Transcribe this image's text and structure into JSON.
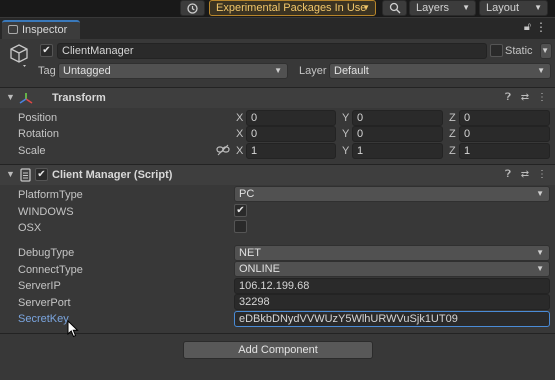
{
  "toolbar": {
    "experimental_label": "Experimental Packages In Use",
    "layers_label": "Layers",
    "layout_label": "Layout"
  },
  "tab": {
    "label": "Inspector"
  },
  "gameobject": {
    "name": "ClientManager",
    "static_label": "Static",
    "tag_label": "Tag",
    "tag_value": "Untagged",
    "layer_label": "Layer",
    "layer_value": "Default"
  },
  "transform": {
    "title": "Transform",
    "position_label": "Position",
    "rotation_label": "Rotation",
    "scale_label": "Scale",
    "position": {
      "x": "0",
      "y": "0",
      "z": "0"
    },
    "rotation": {
      "x": "0",
      "y": "0",
      "z": "0"
    },
    "scale": {
      "x": "1",
      "y": "1",
      "z": "1"
    },
    "axis_x": "X",
    "axis_y": "Y",
    "axis_z": "Z"
  },
  "client_manager": {
    "title": "Client Manager (Script)",
    "platform_type_label": "PlatformType",
    "platform_type_value": "PC",
    "windows_label": "WINDOWS",
    "windows_checked": true,
    "osx_label": "OSX",
    "osx_checked": false,
    "debug_type_label": "DebugType",
    "debug_type_value": "NET",
    "connect_type_label": "ConnectType",
    "connect_type_value": "ONLINE",
    "server_ip_label": "ServerIP",
    "server_ip_value": "106.12.199.68",
    "server_port_label": "ServerPort",
    "server_port_value": "32298",
    "secret_key_label": "SecretKey",
    "secret_key_value": "eDBkbDNydVVWUzY5WlhURWVuSjk1UT09"
  },
  "add_component_label": "Add Component",
  "colors": {
    "accent": "#3a79bb",
    "experimental": "#f1c66a",
    "panel": "#383838",
    "field": "#2a2a2a",
    "focus": "#4a8bd6"
  }
}
